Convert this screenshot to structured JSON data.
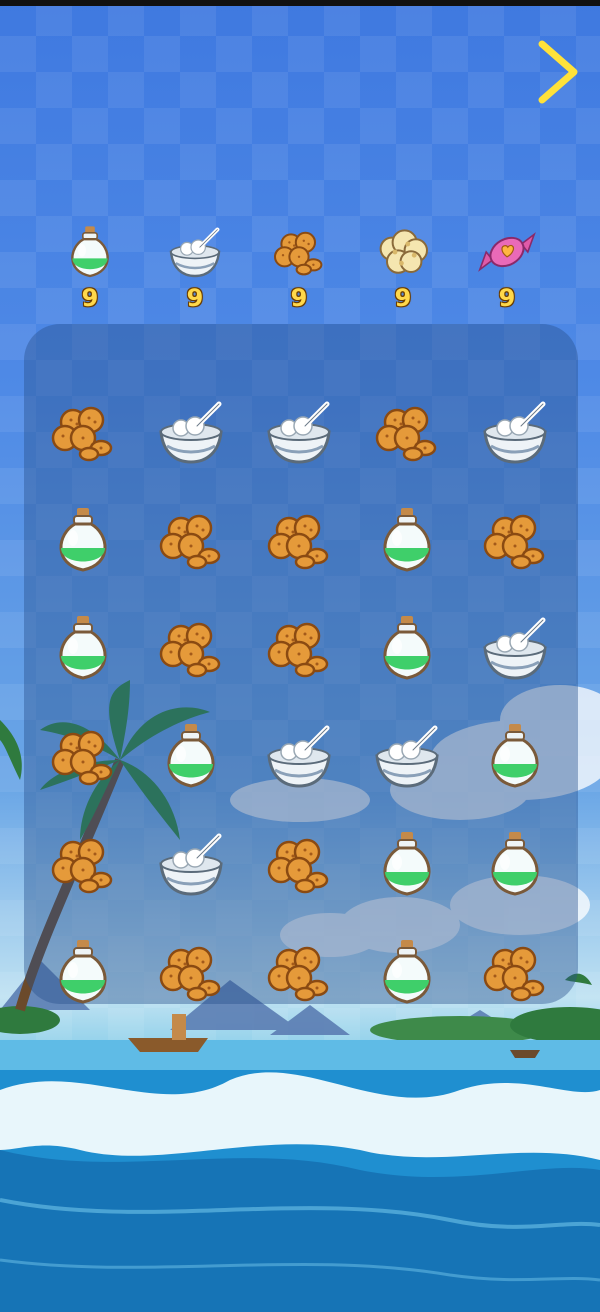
{
  "hud": {
    "next_icon": "chevron-right-icon"
  },
  "goals": [
    {
      "item": "green-potion",
      "count": "9"
    },
    {
      "item": "rice-bowl",
      "count": "9"
    },
    {
      "item": "cookies",
      "count": "9"
    },
    {
      "item": "popcorn",
      "count": "9"
    },
    {
      "item": "candy",
      "count": "9"
    }
  ],
  "board": {
    "rows": [
      [
        "cookies",
        "rice-bowl",
        "rice-bowl",
        "cookies",
        "rice-bowl"
      ],
      [
        "green-potion",
        "cookies",
        "cookies",
        "green-potion",
        "cookies"
      ],
      [
        "green-potion",
        "cookies",
        "cookies",
        "green-potion",
        "rice-bowl"
      ],
      [
        "cookies",
        "green-potion",
        "rice-bowl",
        "rice-bowl",
        "green-potion"
      ],
      [
        "cookies",
        "rice-bowl",
        "cookies",
        "green-potion",
        "green-potion"
      ],
      [
        "green-potion",
        "cookies",
        "cookies",
        "green-potion",
        "cookies"
      ]
    ]
  },
  "colors": {
    "counter": "#ffd84a",
    "arrow": "#ffe23a",
    "potion": "#3fcf6a"
  }
}
